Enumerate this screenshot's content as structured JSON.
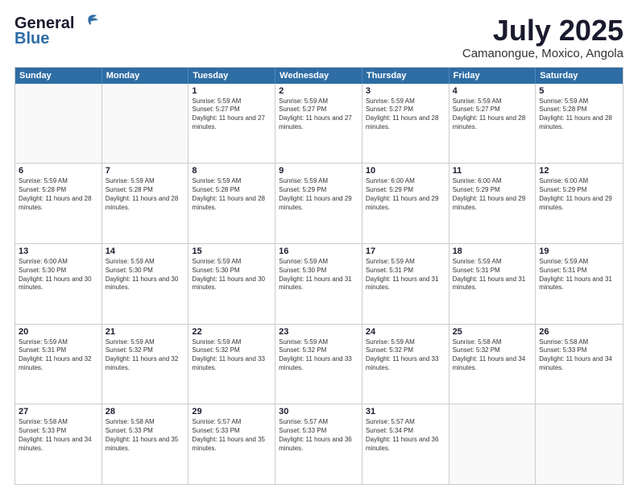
{
  "header": {
    "logo_general": "General",
    "logo_blue": "Blue",
    "month_title": "July 2025",
    "subtitle": "Camanongue, Moxico, Angola"
  },
  "days_of_week": [
    "Sunday",
    "Monday",
    "Tuesday",
    "Wednesday",
    "Thursday",
    "Friday",
    "Saturday"
  ],
  "weeks": [
    [
      {
        "day": "",
        "info": "",
        "empty": true
      },
      {
        "day": "",
        "info": "",
        "empty": true
      },
      {
        "day": "1",
        "info": "Sunrise: 5:59 AM\nSunset: 5:27 PM\nDaylight: 11 hours and 27 minutes."
      },
      {
        "day": "2",
        "info": "Sunrise: 5:59 AM\nSunset: 5:27 PM\nDaylight: 11 hours and 27 minutes."
      },
      {
        "day": "3",
        "info": "Sunrise: 5:59 AM\nSunset: 5:27 PM\nDaylight: 11 hours and 28 minutes."
      },
      {
        "day": "4",
        "info": "Sunrise: 5:59 AM\nSunset: 5:27 PM\nDaylight: 11 hours and 28 minutes."
      },
      {
        "day": "5",
        "info": "Sunrise: 5:59 AM\nSunset: 5:28 PM\nDaylight: 11 hours and 28 minutes."
      }
    ],
    [
      {
        "day": "6",
        "info": "Sunrise: 5:59 AM\nSunset: 5:28 PM\nDaylight: 11 hours and 28 minutes."
      },
      {
        "day": "7",
        "info": "Sunrise: 5:59 AM\nSunset: 5:28 PM\nDaylight: 11 hours and 28 minutes."
      },
      {
        "day": "8",
        "info": "Sunrise: 5:59 AM\nSunset: 5:28 PM\nDaylight: 11 hours and 28 minutes."
      },
      {
        "day": "9",
        "info": "Sunrise: 5:59 AM\nSunset: 5:29 PM\nDaylight: 11 hours and 29 minutes."
      },
      {
        "day": "10",
        "info": "Sunrise: 6:00 AM\nSunset: 5:29 PM\nDaylight: 11 hours and 29 minutes."
      },
      {
        "day": "11",
        "info": "Sunrise: 6:00 AM\nSunset: 5:29 PM\nDaylight: 11 hours and 29 minutes."
      },
      {
        "day": "12",
        "info": "Sunrise: 6:00 AM\nSunset: 5:29 PM\nDaylight: 11 hours and 29 minutes."
      }
    ],
    [
      {
        "day": "13",
        "info": "Sunrise: 6:00 AM\nSunset: 5:30 PM\nDaylight: 11 hours and 30 minutes."
      },
      {
        "day": "14",
        "info": "Sunrise: 5:59 AM\nSunset: 5:30 PM\nDaylight: 11 hours and 30 minutes."
      },
      {
        "day": "15",
        "info": "Sunrise: 5:59 AM\nSunset: 5:30 PM\nDaylight: 11 hours and 30 minutes."
      },
      {
        "day": "16",
        "info": "Sunrise: 5:59 AM\nSunset: 5:30 PM\nDaylight: 11 hours and 31 minutes."
      },
      {
        "day": "17",
        "info": "Sunrise: 5:59 AM\nSunset: 5:31 PM\nDaylight: 11 hours and 31 minutes."
      },
      {
        "day": "18",
        "info": "Sunrise: 5:59 AM\nSunset: 5:31 PM\nDaylight: 11 hours and 31 minutes."
      },
      {
        "day": "19",
        "info": "Sunrise: 5:59 AM\nSunset: 5:31 PM\nDaylight: 11 hours and 31 minutes."
      }
    ],
    [
      {
        "day": "20",
        "info": "Sunrise: 5:59 AM\nSunset: 5:31 PM\nDaylight: 11 hours and 32 minutes."
      },
      {
        "day": "21",
        "info": "Sunrise: 5:59 AM\nSunset: 5:32 PM\nDaylight: 11 hours and 32 minutes."
      },
      {
        "day": "22",
        "info": "Sunrise: 5:59 AM\nSunset: 5:32 PM\nDaylight: 11 hours and 33 minutes."
      },
      {
        "day": "23",
        "info": "Sunrise: 5:59 AM\nSunset: 5:32 PM\nDaylight: 11 hours and 33 minutes."
      },
      {
        "day": "24",
        "info": "Sunrise: 5:59 AM\nSunset: 5:32 PM\nDaylight: 11 hours and 33 minutes."
      },
      {
        "day": "25",
        "info": "Sunrise: 5:58 AM\nSunset: 5:32 PM\nDaylight: 11 hours and 34 minutes."
      },
      {
        "day": "26",
        "info": "Sunrise: 5:58 AM\nSunset: 5:33 PM\nDaylight: 11 hours and 34 minutes."
      }
    ],
    [
      {
        "day": "27",
        "info": "Sunrise: 5:58 AM\nSunset: 5:33 PM\nDaylight: 11 hours and 34 minutes."
      },
      {
        "day": "28",
        "info": "Sunrise: 5:58 AM\nSunset: 5:33 PM\nDaylight: 11 hours and 35 minutes."
      },
      {
        "day": "29",
        "info": "Sunrise: 5:57 AM\nSunset: 5:33 PM\nDaylight: 11 hours and 35 minutes."
      },
      {
        "day": "30",
        "info": "Sunrise: 5:57 AM\nSunset: 5:33 PM\nDaylight: 11 hours and 36 minutes."
      },
      {
        "day": "31",
        "info": "Sunrise: 5:57 AM\nSunset: 5:34 PM\nDaylight: 11 hours and 36 minutes."
      },
      {
        "day": "",
        "info": "",
        "empty": true
      },
      {
        "day": "",
        "info": "",
        "empty": true
      }
    ]
  ]
}
